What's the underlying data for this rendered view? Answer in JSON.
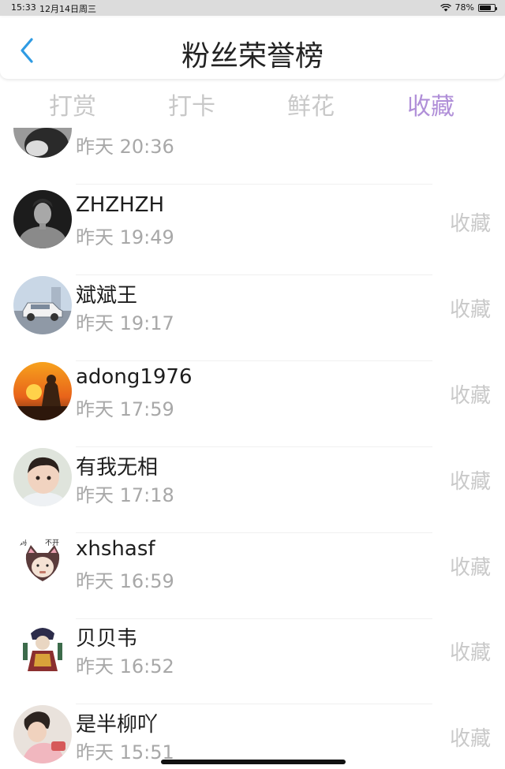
{
  "status_bar": {
    "time": "15:33",
    "date": "12月14日周三",
    "battery": "78%"
  },
  "header": {
    "title": "粉丝荣誉榜"
  },
  "tabs": [
    {
      "label": "打赏",
      "active": false
    },
    {
      "label": "打卡",
      "active": false
    },
    {
      "label": "鲜花",
      "active": false
    },
    {
      "label": "收藏",
      "active": true
    }
  ],
  "colors": {
    "accent": "#b08fd8",
    "muted": "#c8c8c8",
    "back": "#2f9be3"
  },
  "list": [
    {
      "name": "",
      "time": "昨天 20:36",
      "action": "",
      "avatar": "avatar-dark-portrait"
    },
    {
      "name": "ZHZHZH",
      "time": "昨天 19:49",
      "action": "收藏",
      "avatar": "avatar-man-portrait"
    },
    {
      "name": "斌斌王",
      "time": "昨天 19:17",
      "action": "收藏",
      "avatar": "avatar-car"
    },
    {
      "name": "adong1976",
      "time": "昨天 17:59",
      "action": "收藏",
      "avatar": "avatar-sunset-buddha"
    },
    {
      "name": "有我无相",
      "time": "昨天 17:18",
      "action": "收藏",
      "avatar": "avatar-baby"
    },
    {
      "name": "xhshasf",
      "time": "昨天 16:59",
      "action": "收藏",
      "avatar": "avatar-cat-costume-baby"
    },
    {
      "name": "贝贝韦",
      "time": "昨天 16:52",
      "action": "收藏",
      "avatar": "avatar-opera-figure"
    },
    {
      "name": "是半柳吖",
      "time": "昨天 15:51",
      "action": "收藏",
      "avatar": "avatar-child"
    }
  ]
}
